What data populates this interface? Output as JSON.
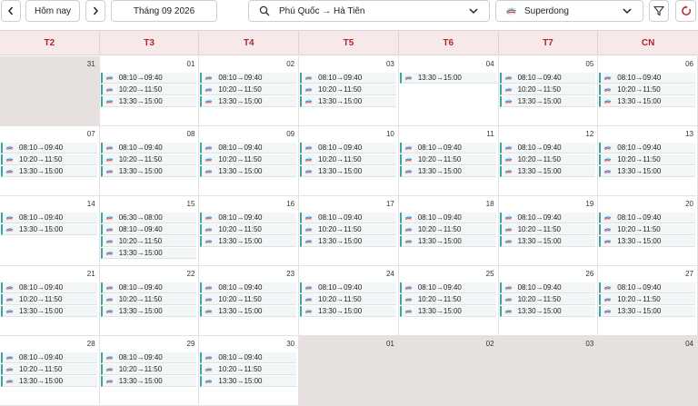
{
  "toolbar": {
    "today_label": "Hôm nay",
    "month_label": "Tháng 09 2026",
    "route_value": "Phú Quốc → Hà Tiên",
    "operator_value": "Superdong"
  },
  "colors": {
    "header_bg": "#f7e9ea",
    "header_text": "#b0282e",
    "other_month_bg": "#e6e1de",
    "trip_accent": "#3fa3a3",
    "refresh_icon": "#c0282e"
  },
  "weekdays": [
    "T2",
    "T3",
    "T4",
    "T5",
    "T6",
    "T7",
    "CN"
  ],
  "weeks": [
    [
      {
        "day": "31",
        "other": true,
        "trips": []
      },
      {
        "day": "01",
        "trips": [
          "08:10→09:40",
          "10:20→11:50",
          "13:30→15:00"
        ]
      },
      {
        "day": "02",
        "trips": [
          "08:10→09:40",
          "10:20→11:50",
          "13:30→15:00"
        ]
      },
      {
        "day": "03",
        "trips": [
          "08:10→09:40",
          "10:20→11:50",
          "13:30→15:00"
        ]
      },
      {
        "day": "04",
        "trips": [
          "13:30→15:00"
        ]
      },
      {
        "day": "05",
        "trips": [
          "08:10→09:40",
          "10:20→11:50",
          "13:30→15:00"
        ]
      },
      {
        "day": "06",
        "trips": [
          "08:10→09:40",
          "10:20→11:50",
          "13:30→15:00"
        ]
      }
    ],
    [
      {
        "day": "07",
        "trips": [
          "08:10→09:40",
          "10:20→11:50",
          "13:30→15:00"
        ]
      },
      {
        "day": "08",
        "trips": [
          "08:10→09:40",
          "10:20→11:50",
          "13:30→15:00"
        ]
      },
      {
        "day": "09",
        "trips": [
          "08:10→09:40",
          "10:20→11:50",
          "13:30→15:00"
        ]
      },
      {
        "day": "10",
        "trips": [
          "08:10→09:40",
          "10:20→11:50",
          "13:30→15:00"
        ]
      },
      {
        "day": "11",
        "trips": [
          "08:10→09:40",
          "10:20→11:50",
          "13:30→15:00"
        ]
      },
      {
        "day": "12",
        "trips": [
          "08:10→09:40",
          "10:20→11:50",
          "13:30→15:00"
        ]
      },
      {
        "day": "13",
        "trips": [
          "08:10→09:40",
          "10:20→11:50",
          "13:30→15:00"
        ]
      }
    ],
    [
      {
        "day": "14",
        "trips": [
          "08:10→09:40",
          "13:30→15:00"
        ]
      },
      {
        "day": "15",
        "trips": [
          "06:30→08:00",
          "08:10→09:40",
          "10:20→11:50",
          "13:30→15:00"
        ]
      },
      {
        "day": "16",
        "trips": [
          "08:10→09:40",
          "10:20→11:50",
          "13:30→15:00"
        ]
      },
      {
        "day": "17",
        "trips": [
          "08:10→09:40",
          "10:20→11:50",
          "13:30→15:00"
        ]
      },
      {
        "day": "18",
        "trips": [
          "08:10→09:40",
          "10:20→11:50",
          "13:30→15:00"
        ]
      },
      {
        "day": "19",
        "trips": [
          "08:10→09:40",
          "10:20→11:50",
          "13:30→15:00"
        ]
      },
      {
        "day": "20",
        "trips": [
          "08:10→09:40",
          "10:20→11:50",
          "13:30→15:00"
        ]
      }
    ],
    [
      {
        "day": "21",
        "trips": [
          "08:10→09:40",
          "10:20→11:50",
          "13:30→15:00"
        ]
      },
      {
        "day": "22",
        "trips": [
          "08:10→09:40",
          "10:20→11:50",
          "13:30→15:00"
        ]
      },
      {
        "day": "23",
        "trips": [
          "08:10→09:40",
          "10:20→11:50",
          "13:30→15:00"
        ]
      },
      {
        "day": "24",
        "trips": [
          "08:10→09:40",
          "10:20→11:50",
          "13:30→15:00"
        ]
      },
      {
        "day": "25",
        "trips": [
          "08:10→09:40",
          "10:20→11:50",
          "13:30→15:00"
        ]
      },
      {
        "day": "26",
        "trips": [
          "08:10→09:40",
          "10:20→11:50",
          "13:30→15:00"
        ]
      },
      {
        "day": "27",
        "trips": [
          "08:10→09:40",
          "10:20→11:50",
          "13:30→15:00"
        ]
      }
    ],
    [
      {
        "day": "28",
        "trips": [
          "08:10→09:40",
          "10:20→11:50",
          "13:30→15:00"
        ]
      },
      {
        "day": "29",
        "trips": [
          "08:10→09:40",
          "10:20→11:50",
          "13:30→15:00"
        ]
      },
      {
        "day": "30",
        "trips": [
          "08:10→09:40",
          "10:20→11:50",
          "13:30→15:00"
        ]
      },
      {
        "day": "01",
        "other": true,
        "trips": []
      },
      {
        "day": "02",
        "other": true,
        "trips": []
      },
      {
        "day": "03",
        "other": true,
        "trips": []
      },
      {
        "day": "04",
        "other": true,
        "trips": []
      }
    ]
  ]
}
